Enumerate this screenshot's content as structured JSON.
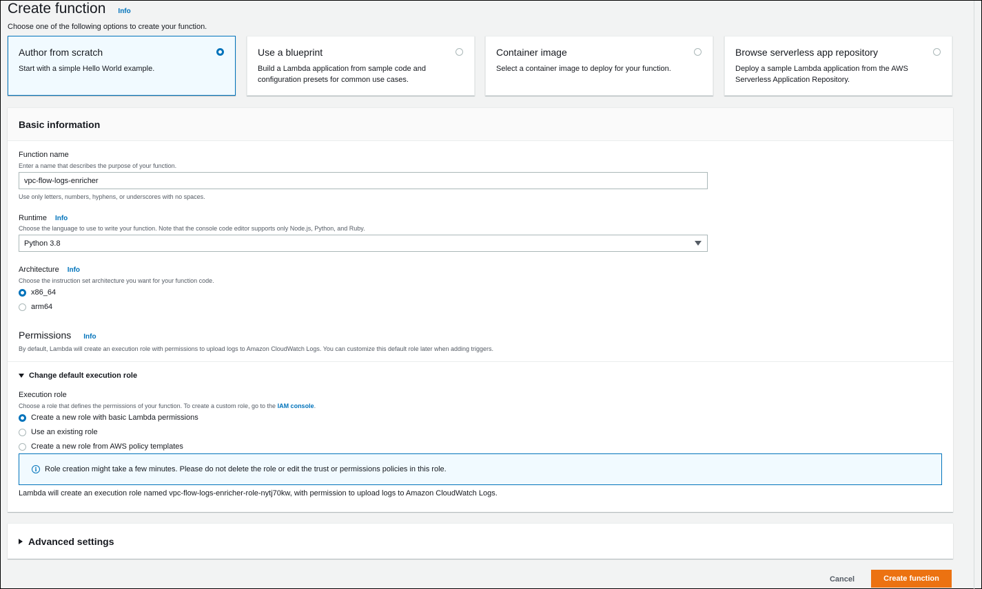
{
  "header": {
    "title": "Create function",
    "info": "Info",
    "subtitle": "Choose one of the following options to create your function."
  },
  "options": [
    {
      "title": "Author from scratch",
      "desc": "Start with a simple Hello World example.",
      "selected": true
    },
    {
      "title": "Use a blueprint",
      "desc": "Build a Lambda application from sample code and configuration presets for common use cases.",
      "selected": false
    },
    {
      "title": "Container image",
      "desc": "Select a container image to deploy for your function.",
      "selected": false
    },
    {
      "title": "Browse serverless app repository",
      "desc": "Deploy a sample Lambda application from the AWS Serverless Application Repository.",
      "selected": false
    }
  ],
  "basic": {
    "title": "Basic information",
    "function_name": {
      "label": "Function name",
      "hint": "Enter a name that describes the purpose of your function.",
      "value": "vpc-flow-logs-enricher",
      "constraint": "Use only letters, numbers, hyphens, or underscores with no spaces."
    },
    "runtime": {
      "label": "Runtime",
      "info": "Info",
      "hint": "Choose the language to use to write your function. Note that the console code editor supports only Node.js, Python, and Ruby.",
      "value": "Python 3.8"
    },
    "architecture": {
      "label": "Architecture",
      "info": "Info",
      "hint": "Choose the instruction set architecture you want for your function code.",
      "options": [
        {
          "label": "x86_64",
          "checked": true
        },
        {
          "label": "arm64",
          "checked": false
        }
      ]
    },
    "permissions": {
      "title": "Permissions",
      "info": "Info",
      "desc": "By default, Lambda will create an execution role with permissions to upload logs to Amazon CloudWatch Logs. You can customize this default role later when adding triggers.",
      "toggle": "Change default execution role",
      "exec_role_label": "Execution role",
      "exec_role_hint": "Choose a role that defines the permissions of your function. To create a custom role, go to the",
      "exec_role_link": "IAM console",
      "exec_role_hint_end": ".",
      "options": [
        {
          "label": "Create a new role with basic Lambda permissions",
          "checked": true
        },
        {
          "label": "Use an existing role",
          "checked": false
        },
        {
          "label": "Create a new role from AWS policy templates",
          "checked": false
        }
      ],
      "alert": "Role creation might take a few minutes. Please do not delete the role or edit the trust or permissions policies in this role.",
      "footer_note": "Lambda will create an execution role named vpc-flow-logs-enricher-role-nytj70kw, with permission to upload logs to Amazon CloudWatch Logs."
    }
  },
  "advanced": {
    "title": "Advanced settings"
  },
  "actions": {
    "cancel": "Cancel",
    "create": "Create function"
  },
  "colors": {
    "accent": "#0073bb",
    "primary_button": "#ec7211"
  }
}
